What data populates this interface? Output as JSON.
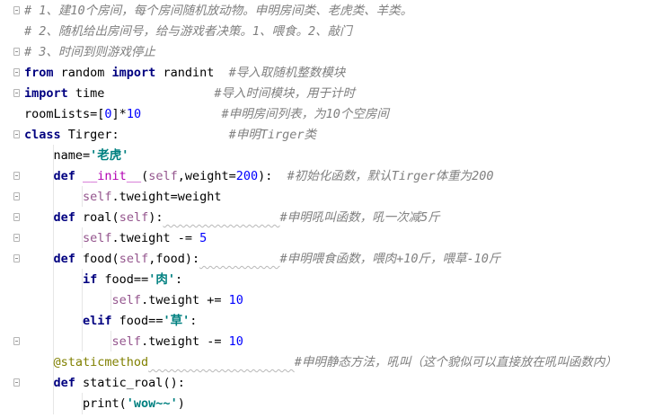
{
  "editor": {
    "language": "python",
    "colors": {
      "keyword": "#000080",
      "comment": "#808080",
      "string": "#008080",
      "number": "#0000ff",
      "self": "#94558d",
      "magic": "#b200b2",
      "decorator": "#808000"
    },
    "lines": [
      [
        {
          "t": "# 1、建10个房间，每个房间随机放动物。申明房间类、老虎类、羊类。",
          "c": "cmt"
        }
      ],
      [
        {
          "t": "# 2、随机给出房间号，给与游戏者决策。1、喂食。2、敲门",
          "c": "cmt"
        }
      ],
      [
        {
          "t": "# 3、时间到则游戏停止",
          "c": "cmt"
        }
      ],
      [
        {
          "t": "from",
          "c": "kw"
        },
        {
          "t": " random ",
          "c": "plain"
        },
        {
          "t": "import",
          "c": "kw"
        },
        {
          "t": " randint  ",
          "c": "plain"
        },
        {
          "t": "#导入取随机整数模块",
          "c": "cmt"
        }
      ],
      [
        {
          "t": "import",
          "c": "kw"
        },
        {
          "t": " time               ",
          "c": "plain"
        },
        {
          "t": "#导入时间模块，用于计时",
          "c": "cmt"
        }
      ],
      [
        {
          "t": "roomLists=[",
          "c": "plain"
        },
        {
          "t": "0",
          "c": "num"
        },
        {
          "t": "]*",
          "c": "plain"
        },
        {
          "t": "10",
          "c": "num"
        },
        {
          "t": "           ",
          "c": "plain"
        },
        {
          "t": "#申明房间列表，为10个空房间",
          "c": "cmt"
        }
      ],
      [
        {
          "t": "class",
          "c": "kw"
        },
        {
          "t": " Tirger:               ",
          "c": "plain"
        },
        {
          "t": "#申明Tirger类",
          "c": "cmt"
        }
      ],
      [
        {
          "t": "    name=",
          "c": "plain"
        },
        {
          "t": "'老虎'",
          "c": "str"
        }
      ],
      [
        {
          "t": "    ",
          "c": "plain"
        },
        {
          "t": "def",
          "c": "kw"
        },
        {
          "t": " ",
          "c": "plain"
        },
        {
          "t": "__init__",
          "c": "magic"
        },
        {
          "t": "(",
          "c": "plain"
        },
        {
          "t": "self",
          "c": "self"
        },
        {
          "t": ",weight=",
          "c": "plain"
        },
        {
          "t": "200",
          "c": "num"
        },
        {
          "t": "):  ",
          "c": "plain"
        },
        {
          "t": "#初始化函数，默认Tirger体重为200",
          "c": "cmt"
        }
      ],
      [
        {
          "t": "        ",
          "c": "plain"
        },
        {
          "t": "self",
          "c": "self"
        },
        {
          "t": ".tweight=weight",
          "c": "plain"
        }
      ],
      [
        {
          "t": "    ",
          "c": "plain"
        },
        {
          "t": "def",
          "c": "kw"
        },
        {
          "t": " roal(",
          "c": "plain"
        },
        {
          "t": "self",
          "c": "self"
        },
        {
          "t": "):",
          "c": "plain"
        },
        {
          "t": "                ",
          "c": "plain wavy"
        },
        {
          "t": "#申明吼叫函数，吼一次减5斤",
          "c": "cmt"
        }
      ],
      [
        {
          "t": "        ",
          "c": "plain"
        },
        {
          "t": "self",
          "c": "self"
        },
        {
          "t": ".tweight -= ",
          "c": "plain"
        },
        {
          "t": "5",
          "c": "num"
        }
      ],
      [
        {
          "t": "    ",
          "c": "plain"
        },
        {
          "t": "def",
          "c": "kw"
        },
        {
          "t": " food(",
          "c": "plain"
        },
        {
          "t": "self",
          "c": "self"
        },
        {
          "t": ",food):",
          "c": "plain"
        },
        {
          "t": "           ",
          "c": "plain wavy"
        },
        {
          "t": "#申明喂食函数，喂肉+10斤，喂草-10斤",
          "c": "cmt"
        }
      ],
      [
        {
          "t": "        ",
          "c": "plain"
        },
        {
          "t": "if",
          "c": "kw"
        },
        {
          "t": " food==",
          "c": "plain"
        },
        {
          "t": "'肉'",
          "c": "str"
        },
        {
          "t": ":",
          "c": "plain"
        }
      ],
      [
        {
          "t": "            ",
          "c": "plain"
        },
        {
          "t": "self",
          "c": "self"
        },
        {
          "t": ".tweight += ",
          "c": "plain"
        },
        {
          "t": "10",
          "c": "num"
        }
      ],
      [
        {
          "t": "        ",
          "c": "plain"
        },
        {
          "t": "elif",
          "c": "kw"
        },
        {
          "t": " food==",
          "c": "plain"
        },
        {
          "t": "'草'",
          "c": "str"
        },
        {
          "t": ":",
          "c": "plain"
        }
      ],
      [
        {
          "t": "            ",
          "c": "plain"
        },
        {
          "t": "self",
          "c": "self"
        },
        {
          "t": ".tweight -= ",
          "c": "plain"
        },
        {
          "t": "10",
          "c": "num"
        }
      ],
      [
        {
          "t": "    ",
          "c": "plain"
        },
        {
          "t": "@staticmethod",
          "c": "deco"
        },
        {
          "t": "                    ",
          "c": "plain wavy"
        },
        {
          "t": "#申明静态方法，吼叫（这个貌似可以直接放在吼叫函数内）",
          "c": "cmt"
        }
      ],
      [
        {
          "t": "    ",
          "c": "plain"
        },
        {
          "t": "def",
          "c": "kw"
        },
        {
          "t": " static_roal():",
          "c": "plain"
        }
      ],
      [
        {
          "t": "        print(",
          "c": "plain"
        },
        {
          "t": "'wow~~'",
          "c": "str"
        },
        {
          "t": ")",
          "c": "plain"
        }
      ]
    ]
  }
}
